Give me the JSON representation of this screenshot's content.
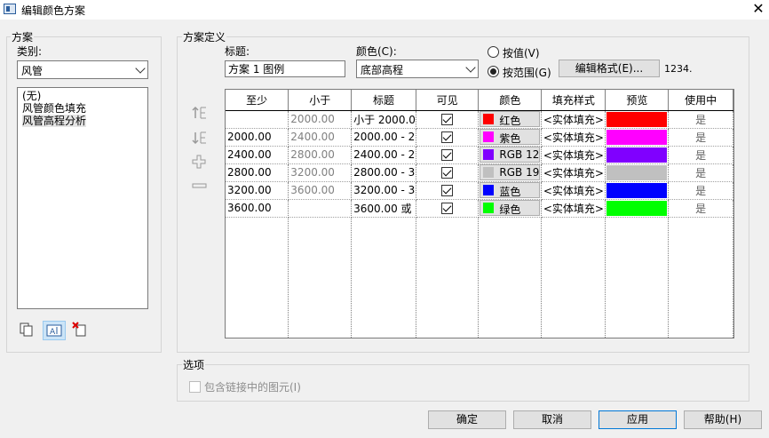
{
  "window": {
    "title": "编辑颜色方案"
  },
  "scheme": {
    "group_label": "方案",
    "category_label": "类别:",
    "category_value": "风管",
    "list_items": [
      "(无)",
      "风管颜色填充",
      "风管高程分析"
    ],
    "selected_index": 2
  },
  "definition": {
    "group_label": "方案定义",
    "title_label": "标题:",
    "title_value": "方案 1 图例",
    "color_label": "颜色(C):",
    "color_value": "底部高程",
    "by_value_label": "按值(V)",
    "by_range_label": "按范围(G)",
    "by_range_selected": true,
    "edit_format_label": "编辑格式(E)...",
    "format_sample": "1234."
  },
  "table": {
    "headers": [
      "至少",
      "小于",
      "标题",
      "可见",
      "颜色",
      "填充样式",
      "预览",
      "使用中"
    ],
    "rows": [
      {
        "min": "",
        "max": "2000.00",
        "title": "小于 2000.0",
        "visible": true,
        "color_name": "红色",
        "color_hex": "#ff0000",
        "fill": "<实体填充>",
        "in_use": "是"
      },
      {
        "min": "2000.00",
        "max": "2400.00",
        "title": "2000.00 - 2",
        "visible": true,
        "color_name": "紫色",
        "color_hex": "#ff00ff",
        "fill": "<实体填充>",
        "in_use": "是"
      },
      {
        "min": "2400.00",
        "max": "2800.00",
        "title": "2400.00 - 2",
        "visible": true,
        "color_name": "RGB 12",
        "color_hex": "#8000ff",
        "fill": "<实体填充>",
        "in_use": "是"
      },
      {
        "min": "2800.00",
        "max": "3200.00",
        "title": "2800.00 - 3",
        "visible": true,
        "color_name": "RGB 19",
        "color_hex": "#c0c0c0",
        "fill": "<实体填充>",
        "in_use": "是"
      },
      {
        "min": "3200.00",
        "max": "3600.00",
        "title": "3200.00 - 3",
        "visible": true,
        "color_name": "蓝色",
        "color_hex": "#0000ff",
        "fill": "<实体填充>",
        "in_use": "是"
      },
      {
        "min": "3600.00",
        "max": "",
        "title": "3600.00 或",
        "visible": true,
        "color_name": "绿色",
        "color_hex": "#00ff00",
        "fill": "<实体填充>",
        "in_use": "是"
      }
    ]
  },
  "options": {
    "group_label": "选项",
    "include_links_label": "包含链接中的图元(I)",
    "include_links_checked": false
  },
  "buttons": {
    "ok": "确定",
    "cancel": "取消",
    "apply": "应用",
    "help": "帮助(H)"
  },
  "icons": {
    "move_up": "move-up-icon",
    "move_down": "move-down-icon",
    "add": "add-row-icon",
    "remove": "remove-row-icon",
    "duplicate": "duplicate-scheme-icon",
    "rename": "rename-scheme-icon",
    "delete": "delete-scheme-icon"
  }
}
